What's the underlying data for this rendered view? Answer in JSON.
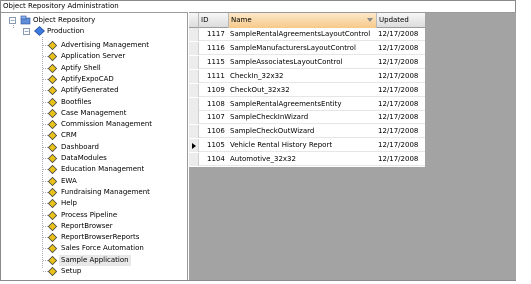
{
  "window": {
    "title": "Object Repository Administration"
  },
  "tree": {
    "root_label": "Object Repository",
    "folder_label": "Production",
    "items": [
      {
        "label": "Advertising Management"
      },
      {
        "label": "Application Server"
      },
      {
        "label": "Aptify Shell"
      },
      {
        "label": "AptifyExpoCAD"
      },
      {
        "label": "AptifyGenerated"
      },
      {
        "label": "Bootfiles"
      },
      {
        "label": "Case Management"
      },
      {
        "label": "Commission Management"
      },
      {
        "label": "CRM"
      },
      {
        "label": "Dashboard"
      },
      {
        "label": "DataModules"
      },
      {
        "label": "Education Management"
      },
      {
        "label": "EWA"
      },
      {
        "label": "Fundraising Management"
      },
      {
        "label": "Help"
      },
      {
        "label": "Process Pipeline"
      },
      {
        "label": "ReportBrowser"
      },
      {
        "label": "ReportBrowserReports"
      },
      {
        "label": "Sales Force Automation"
      },
      {
        "label": "Sample Application"
      },
      {
        "label": "Setup"
      }
    ],
    "selected_item": "Sample Application",
    "expand_root_glyph": "−",
    "expand_folder_glyph": "−"
  },
  "grid": {
    "columns": [
      {
        "key": "id",
        "label": "ID"
      },
      {
        "key": "name",
        "label": "Name"
      },
      {
        "key": "updated",
        "label": "Updated"
      }
    ],
    "rows": [
      {
        "id": "1117",
        "name": "SampleRentalAgreementsLayoutControl",
        "updated": "12/17/2008"
      },
      {
        "id": "1116",
        "name": "SampleManufacturersLayoutControl",
        "updated": "12/17/2008"
      },
      {
        "id": "1115",
        "name": "SampleAssociatesLayoutControl",
        "updated": "12/17/2008"
      },
      {
        "id": "1111",
        "name": "CheckIn_32x32",
        "updated": "12/17/2008"
      },
      {
        "id": "1109",
        "name": "CheckOut_32x32",
        "updated": "12/17/2008"
      },
      {
        "id": "1108",
        "name": "SampleRentalAgreementsEntity",
        "updated": "12/17/2008"
      },
      {
        "id": "1107",
        "name": "SampleCheckInWizard",
        "updated": "12/17/2008"
      },
      {
        "id": "1106",
        "name": "SampleCheckOutWizard",
        "updated": "12/17/2008"
      },
      {
        "id": "1105",
        "name": "Vehicle Rental History Report",
        "updated": "12/17/2008"
      },
      {
        "id": "1104",
        "name": "Automotive_32x32",
        "updated": "12/17/2008"
      }
    ],
    "current_row_index": 8
  },
  "icons": {
    "repository": "repository-icon",
    "folder": "production-folder-icon",
    "item": "diamond-object-icon"
  },
  "colors": {
    "header_highlight": "#f6c98a",
    "grid_background": "#a3a3a3",
    "diamond_fill": "#e8c21a",
    "diamond_border": "#3a3a3a"
  }
}
